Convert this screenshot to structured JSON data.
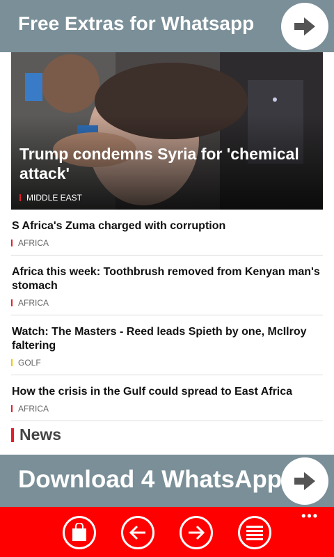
{
  "top_banner": {
    "title": "Free Extras for Whatsapp",
    "arrow_icon": "arrow-right-icon"
  },
  "hero": {
    "title": "Trump condemns Syria for 'chemical attack'",
    "tag": "MIDDLE EAST",
    "tag_color": "#e0202b"
  },
  "articles": [
    {
      "title": "S Africa's Zuma charged with corruption",
      "tag": "AFRICA",
      "tag_color": "#e0202b"
    },
    {
      "title": "Africa this week: Toothbrush removed from Kenyan man's stomach",
      "tag": "AFRICA",
      "tag_color": "#e0202b"
    },
    {
      "title": "Watch: The Masters - Reed leads Spieth by one, McIlroy faltering",
      "tag": "GOLF",
      "tag_color": "#f2c500"
    },
    {
      "title": "How the crisis in the Gulf could spread to East Africa",
      "tag": "AFRICA",
      "tag_color": "#e0202b"
    }
  ],
  "section": {
    "label": "News",
    "accent": "#e0202b"
  },
  "bottom_banner": {
    "title": "Download 4 WhatsApp",
    "arrow_icon": "arrow-right-icon"
  },
  "appbar": {
    "background": "#ff0000",
    "more": "•••",
    "buttons": [
      "shopping-bag-icon",
      "back-arrow-icon",
      "forward-arrow-icon",
      "list-icon"
    ]
  }
}
